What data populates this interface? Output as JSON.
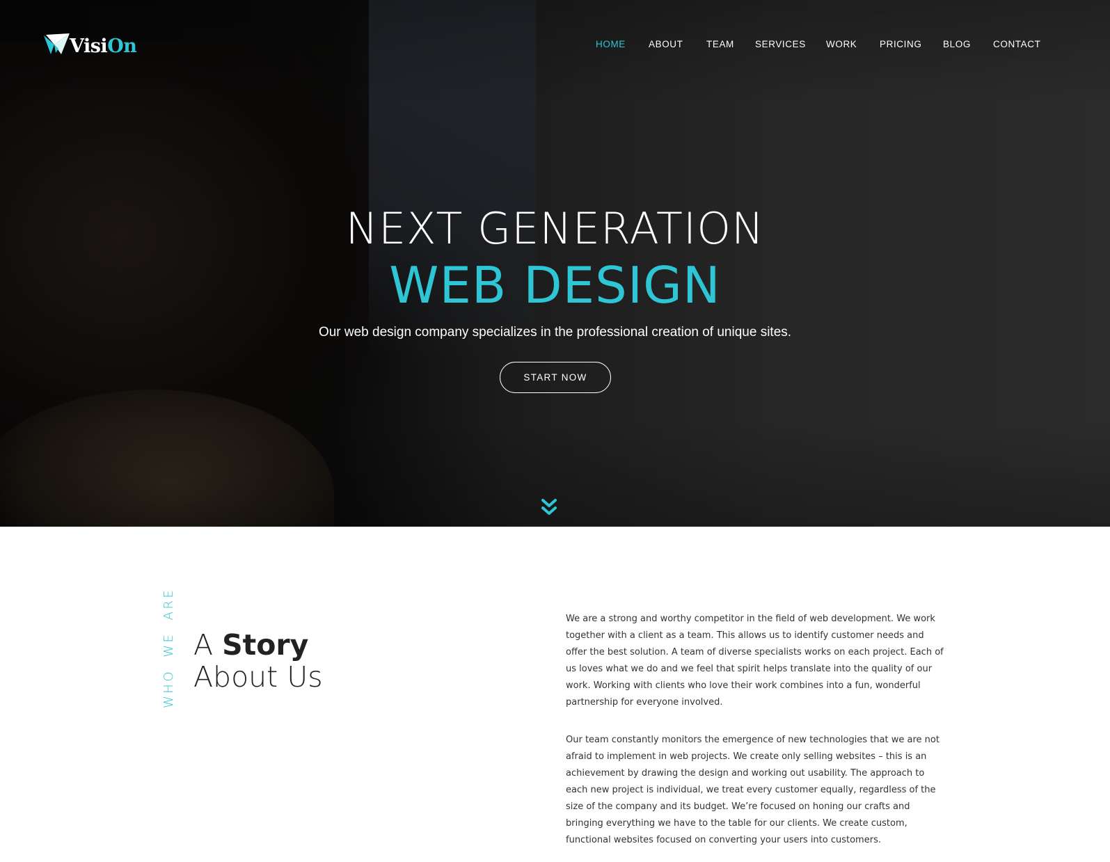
{
  "brand": {
    "logo_text_main": "Visi",
    "logo_text_accent": "On",
    "accent_color": "#2ec5d4"
  },
  "nav": {
    "items": [
      {
        "label": "HOME",
        "active": true
      },
      {
        "label": "ABOUT",
        "active": false
      },
      {
        "label": "TEAM",
        "active": false
      },
      {
        "label": "SERVICES",
        "active": false
      },
      {
        "label": "WORK",
        "active": false
      },
      {
        "label": "PRICING",
        "active": false
      },
      {
        "label": "BLOG",
        "active": false
      },
      {
        "label": "CONTACT",
        "active": false
      }
    ]
  },
  "hero": {
    "line1": "NEXT GENERATION",
    "line2": "WEB DESIGN",
    "subtitle": "Our web design company specializes in the professional creation of unique sites.",
    "button_label": "START NOW",
    "scroll_icon": "chevron-double-down-icon"
  },
  "about": {
    "eyebrow": "WHO WE ARE",
    "title_prefix": "A ",
    "title_bold": "Story",
    "title_line2": "About Us",
    "paragraphs": [
      "We are a strong and worthy competitor in the field of web development. We work together with a client as a team. This allows us to identify customer needs and offer the best solution. A team of diverse specialists works on each project. Each of us loves what we do and we feel that spirit helps translate into the quality of our work. Working with clients who love their work combines into a fun, wonderful partnership for everyone involved.",
      "Our team constantly monitors the emergence of new technologies that we are not afraid to implement in web projects. We create only selling websites – this is an achievement by drawing the design and working out usability. The approach to each new project is individual, we treat every customer equally, regardless of the size of the company and its budget. We’re focused on honing our crafts and bringing everything we have to the table for our clients. We create custom, functional websites focused on converting your users into customers."
    ]
  }
}
